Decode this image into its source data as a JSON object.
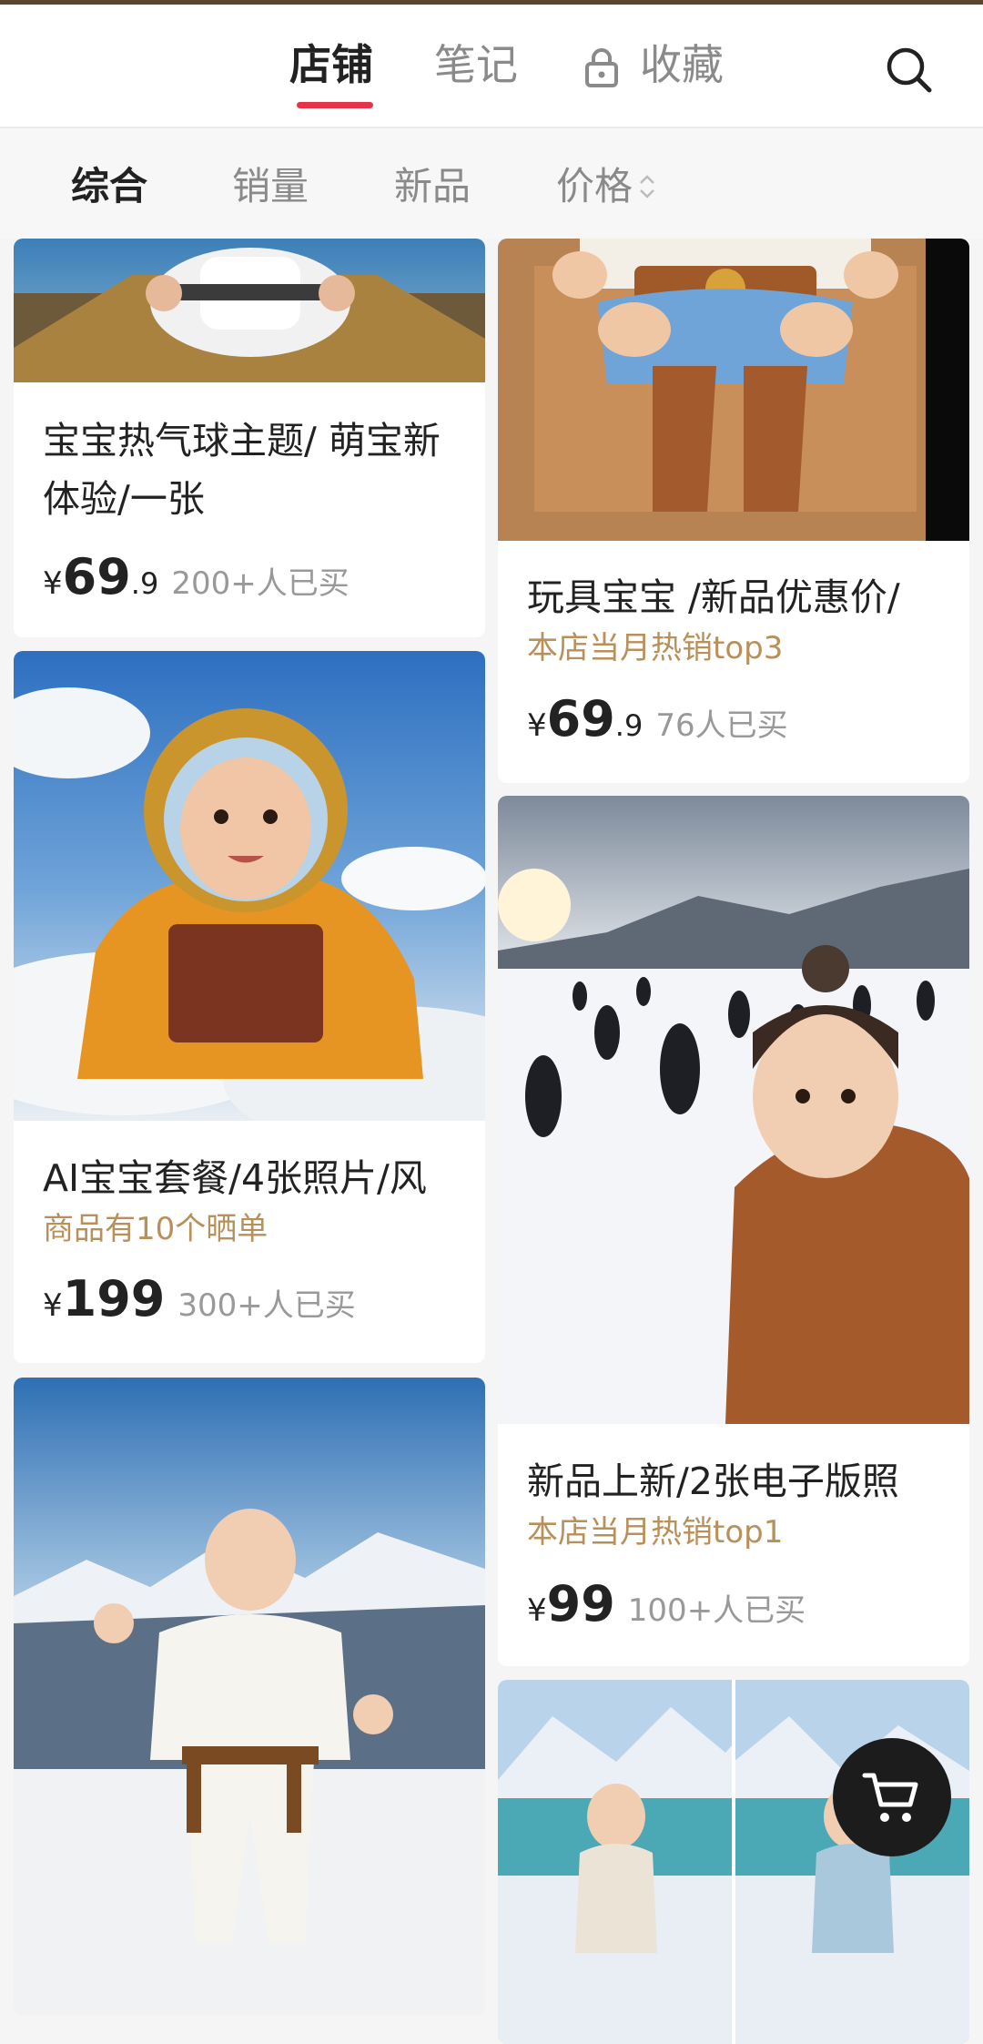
{
  "header": {
    "tabs": [
      {
        "label": "店铺",
        "active": true
      },
      {
        "label": "笔记",
        "active": false
      },
      {
        "label": "收藏",
        "active": false
      }
    ],
    "lock_icon": "lock-icon",
    "search_icon": "search-icon",
    "accent_color": "#e5334a"
  },
  "sort": {
    "options": [
      "综合",
      "销量",
      "新品",
      "价格"
    ],
    "active_index": 0
  },
  "products": [
    {
      "title": "宝宝热气球主题/ 萌宝新体验/一张",
      "tag": "",
      "currency": "¥",
      "price_int": "69",
      "price_dec": ".9",
      "sold": "200+人已买",
      "image": "baby in hot air balloon basket"
    },
    {
      "title": "玩具宝宝 /新品优惠价/",
      "tag": "本店当月热销top3",
      "currency": "¥",
      "price_int": "69",
      "price_dec": ".9",
      "sold": "76人已买",
      "image": "toy cowboy baby in cardboard box"
    },
    {
      "title": "AI宝宝套餐/4张照片/风",
      "tag": "商品有10个晒单",
      "currency": "¥",
      "price_int": "199",
      "price_dec": "",
      "sold": "300+人已买",
      "image": "baby astronaut skydiving above clouds"
    },
    {
      "title": "新品上新/2张电子版照",
      "tag": "本店当月热销top1",
      "currency": "¥",
      "price_int": "99",
      "price_dec": "",
      "sold": "100+人已买",
      "image": "baby selfie with penguins on snow"
    },
    {
      "title": "",
      "tag": "",
      "image": "baby in karate gi on snowy mountain"
    },
    {
      "title": "",
      "tag": "",
      "image": "two babies ice skating by glacier lake"
    }
  ],
  "cart": {
    "icon": "cart-icon"
  }
}
